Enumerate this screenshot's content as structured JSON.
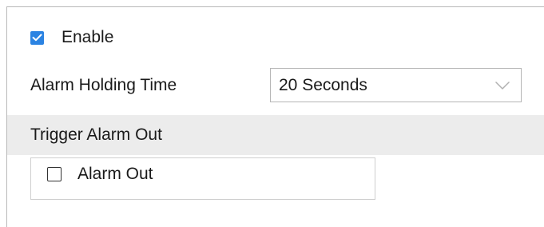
{
  "enable": {
    "label": "Enable",
    "checked": true
  },
  "alarm_holding_time": {
    "label": "Alarm Holding Time",
    "selected": "20 Seconds"
  },
  "trigger_section": {
    "title": "Trigger Alarm Out",
    "items": [
      {
        "label": "Alarm Out",
        "checked": false
      }
    ]
  },
  "colors": {
    "accent": "#2b83e2",
    "section_header_bg": "#ececec",
    "border": "#b6b6b6"
  },
  "icons": {
    "enable_checkbox": "checkbox-checked-icon",
    "select_arrow": "chevron-down-icon",
    "alarm_checkbox": "checkbox-unchecked-icon"
  }
}
